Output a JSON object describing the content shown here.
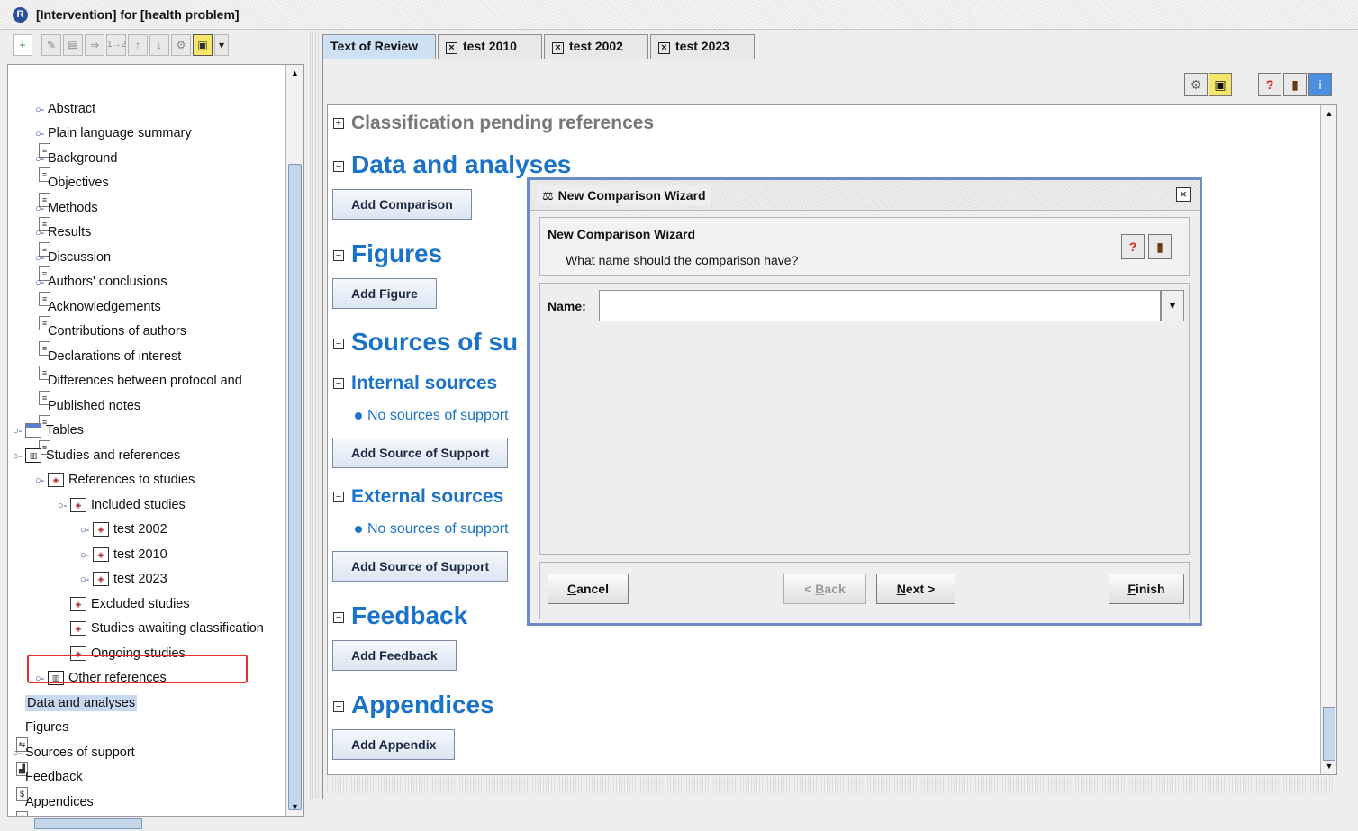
{
  "window": {
    "title": "[Intervention] for [health problem]",
    "app_icon": "R"
  },
  "tree": {
    "items": [
      {
        "label": "Abstract",
        "icon": "document-icon"
      },
      {
        "label": "Plain language summary",
        "icon": "document-icon"
      },
      {
        "label": "Background",
        "icon": "document-icon"
      },
      {
        "label": "Objectives",
        "icon": "document-icon"
      },
      {
        "label": "Methods",
        "icon": "document-icon"
      },
      {
        "label": "Results",
        "icon": "document-icon"
      },
      {
        "label": "Discussion",
        "icon": "document-icon"
      },
      {
        "label": "Authors' conclusions",
        "icon": "document-icon"
      },
      {
        "label": "Acknowledgements",
        "icon": "document-icon"
      },
      {
        "label": "Contributions of authors",
        "icon": "document-icon"
      },
      {
        "label": "Declarations of interest",
        "icon": "document-icon"
      },
      {
        "label": "Differences between protocol and",
        "icon": "document-icon"
      },
      {
        "label": "Published notes",
        "icon": "document-icon"
      },
      {
        "label": "Tables",
        "icon": "table-icon"
      },
      {
        "label": "Studies and references",
        "icon": "book-icon"
      },
      {
        "label": "References to studies",
        "icon": "studies-icon"
      },
      {
        "label": "Included studies",
        "icon": "studies-icon"
      },
      {
        "label": "test 2002",
        "icon": "study-icon"
      },
      {
        "label": "test 2010",
        "icon": "study-icon"
      },
      {
        "label": "test 2023",
        "icon": "study-icon"
      },
      {
        "label": "Excluded studies",
        "icon": "studies-icon"
      },
      {
        "label": "Studies awaiting classification",
        "icon": "studies-icon"
      },
      {
        "label": "Ongoing studies",
        "icon": "studies-icon"
      },
      {
        "label": "Other references",
        "icon": "book-icon"
      },
      {
        "label": "Data and analyses",
        "icon": "data-analyses-icon",
        "selected": true
      },
      {
        "label": "Figures",
        "icon": "figure-icon"
      },
      {
        "label": "Sources of support",
        "icon": "support-icon"
      },
      {
        "label": "Feedback",
        "icon": "feedback-icon"
      },
      {
        "label": "Appendices",
        "icon": "document-icon"
      }
    ]
  },
  "tabs": [
    {
      "label": "Text of Review",
      "active": true,
      "closable": false
    },
    {
      "label": "test 2010",
      "active": false,
      "closable": true
    },
    {
      "label": "test 2002",
      "active": false,
      "closable": true
    },
    {
      "label": "test 2023",
      "active": false,
      "closable": true
    }
  ],
  "document": {
    "classification_pending": "Classification pending references",
    "data_analyses": "Data and analyses",
    "add_comparison": "Add Comparison",
    "figures": "Figures",
    "add_figure": "Add Figure",
    "sources_of_support": "Sources of su",
    "internal_sources": "Internal sources",
    "internal_none": "No sources of support",
    "add_source_1": "Add Source of Support",
    "external_sources": "External sources",
    "external_none": "No sources of support",
    "add_source_2": "Add Source of Support",
    "feedback": "Feedback",
    "add_feedback": "Add Feedback",
    "appendices": "Appendices",
    "add_appendix": "Add Appendix"
  },
  "dialog": {
    "title": "New Comparison Wizard",
    "heading": "New Comparison Wizard",
    "question": "What name should the comparison have?",
    "name_label": "Name:",
    "name_value": "",
    "cancel": "Cancel",
    "back": "< Back",
    "next": "Next >",
    "finish": "Finish"
  },
  "colors": {
    "heading": "#1a73c8",
    "selection": "#c8d8f0",
    "highlight": "#e53030",
    "dialog_border": "#6d8cc6"
  }
}
